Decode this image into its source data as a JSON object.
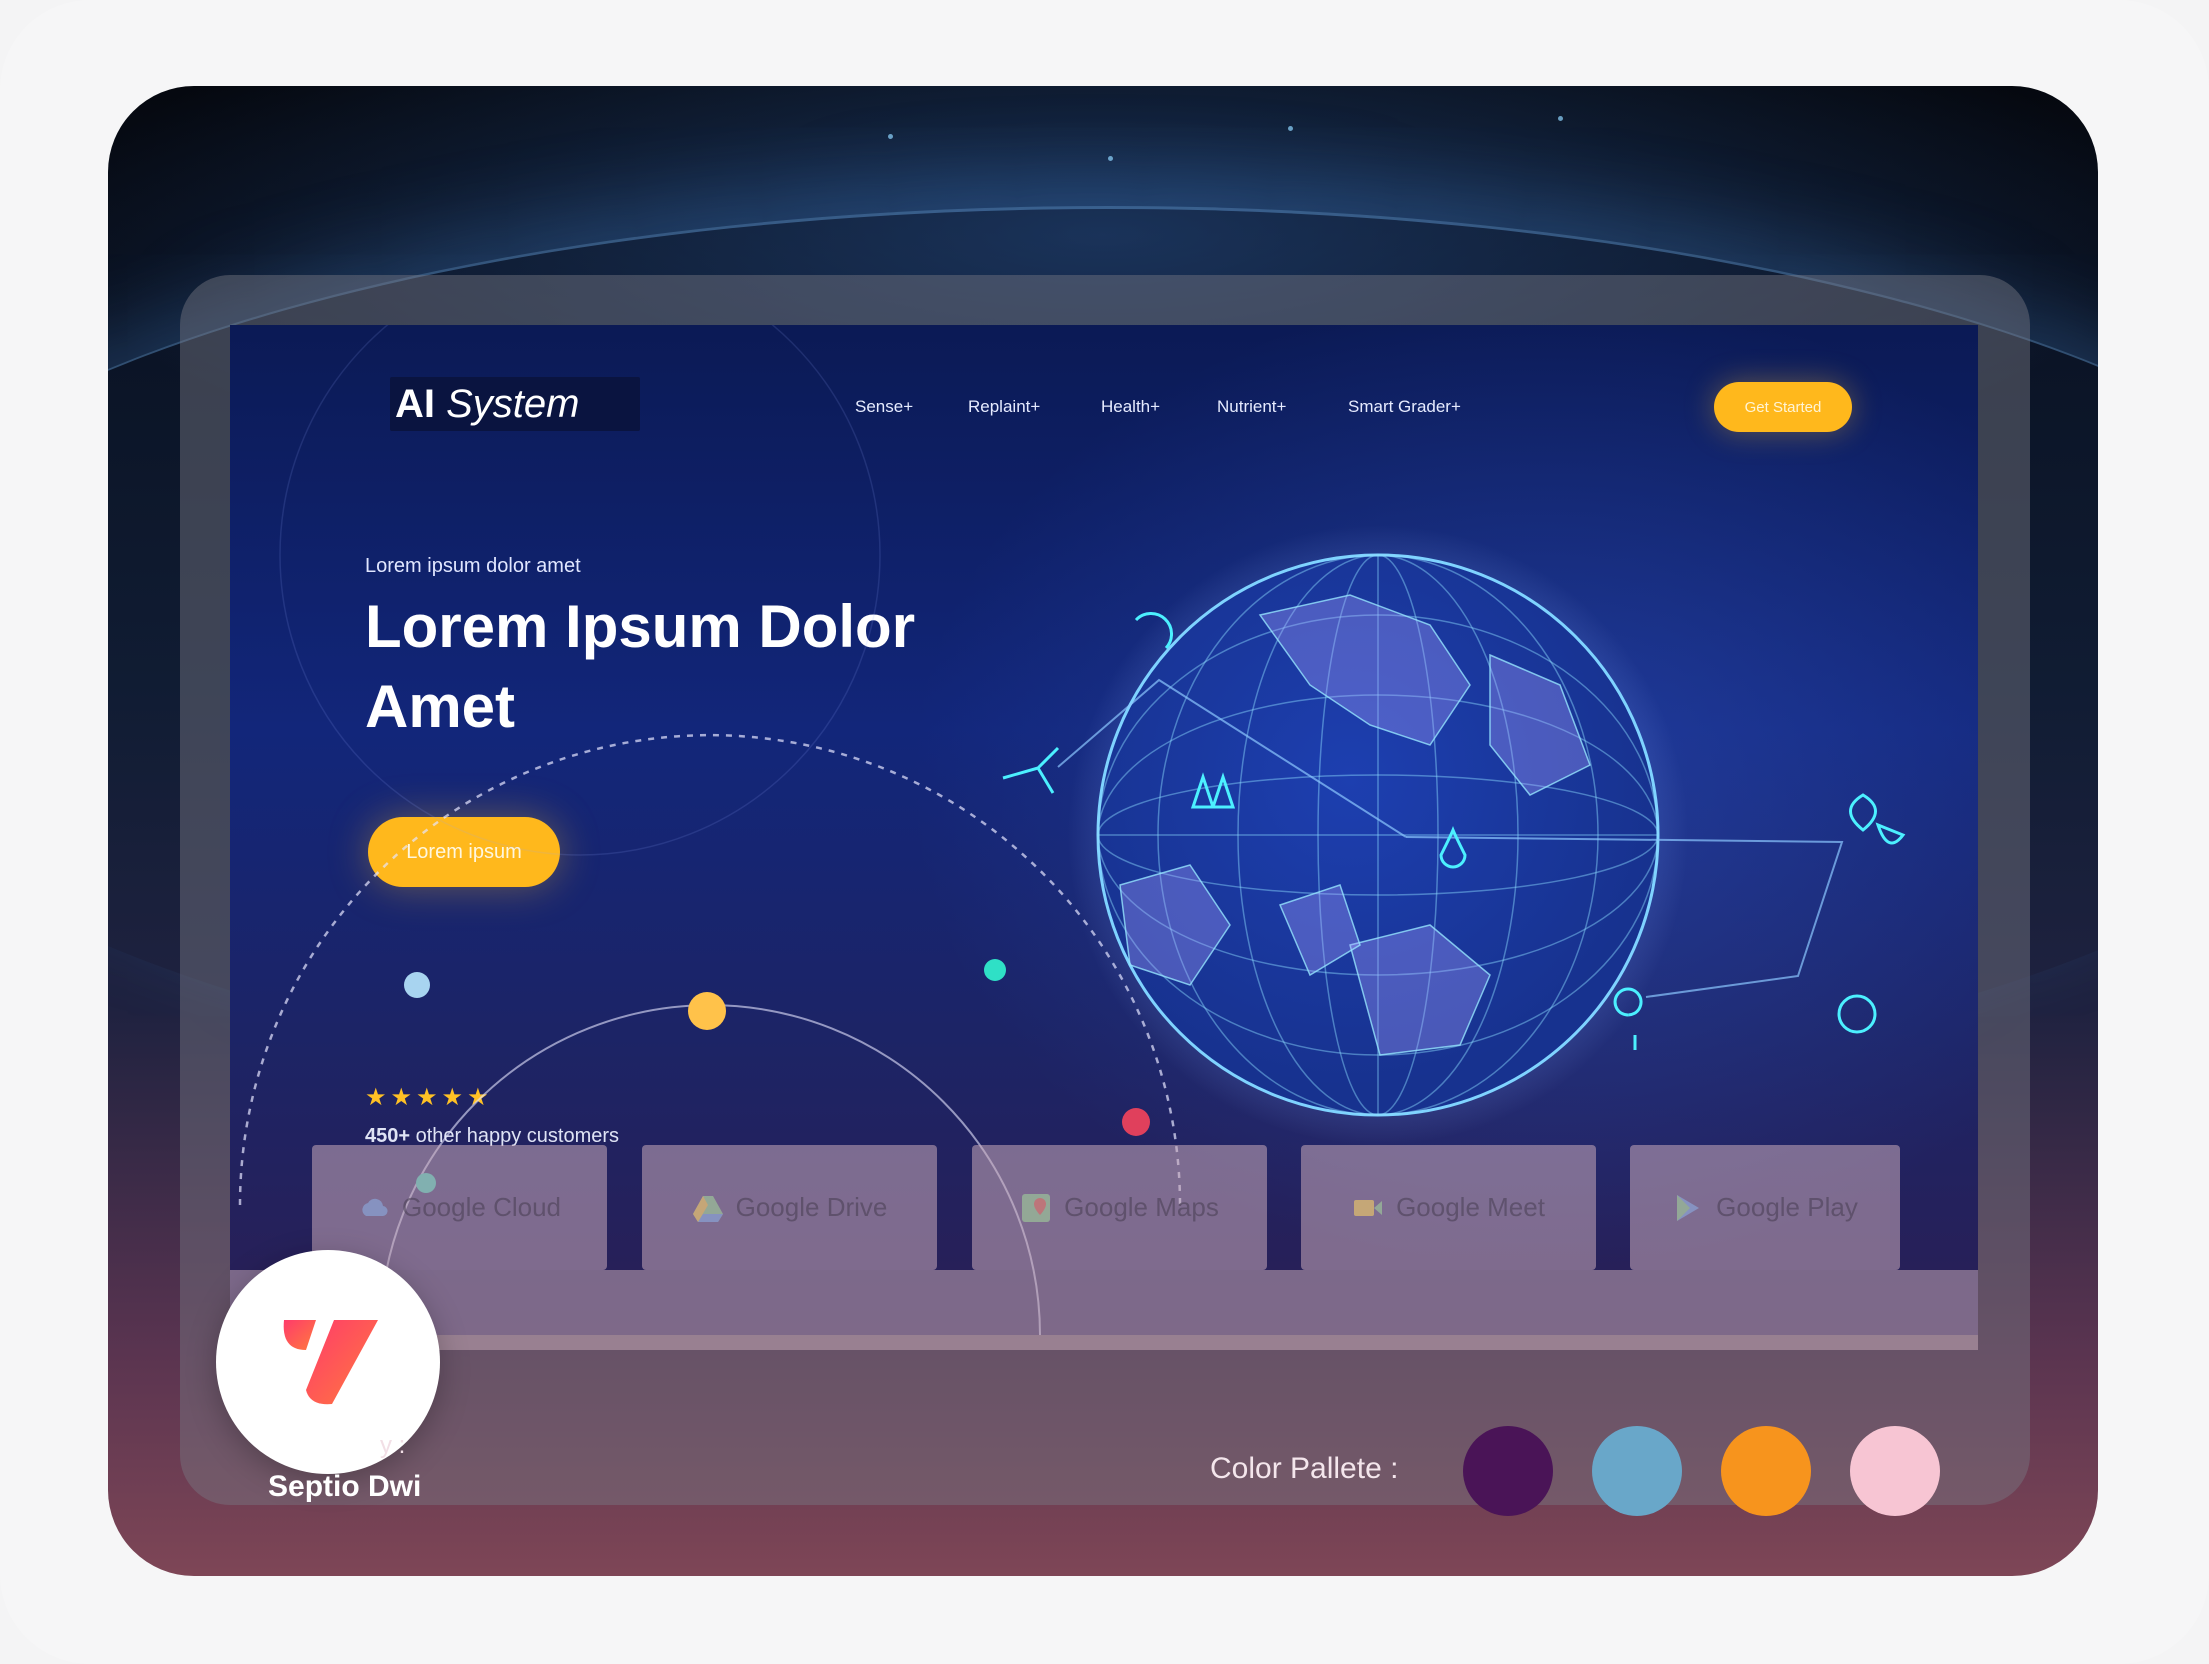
{
  "nav": {
    "brand_bold": "AI",
    "brand_italic": "System",
    "items": [
      {
        "label": "Sense+"
      },
      {
        "label": "Replaint+"
      },
      {
        "label": "Health+"
      },
      {
        "label": "Nutrient+"
      },
      {
        "label": "Smart Grader+"
      }
    ],
    "cta": "Get Started"
  },
  "hero": {
    "kicker": "Lorem ipsum dolor amet",
    "title": "Lorem Ipsum Dolor Amet",
    "button": "Lorem ipsum",
    "rating_stars": "★★★★★",
    "customers_count": "450+",
    "customers_text": " other happy customers"
  },
  "brands": [
    {
      "label": "Google Cloud",
      "icon": "google-cloud-icon"
    },
    {
      "label": "Google Drive",
      "icon": "google-drive-icon"
    },
    {
      "label": "Google Maps",
      "icon": "google-maps-icon"
    },
    {
      "label": "Google Meet",
      "icon": "google-meet-icon"
    },
    {
      "label": "Google Play",
      "icon": "google-play-icon"
    }
  ],
  "footer": {
    "author_prefix": "y :",
    "author": "Septio Dwi",
    "palette_label": "Color Pallete :",
    "palette": [
      "#4a1457",
      "#69a7c9",
      "#f7941d",
      "#f7c5d3"
    ]
  },
  "colors": {
    "accent": "#ffb81c",
    "hero_bg": "#12267a",
    "logo_gradient": [
      "#ff3b6b",
      "#ff7a3d"
    ]
  }
}
